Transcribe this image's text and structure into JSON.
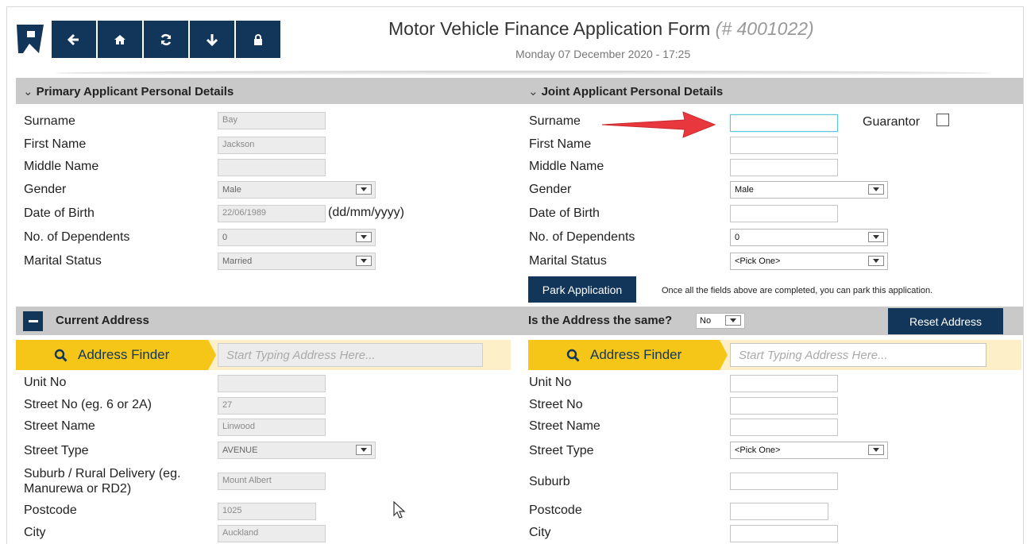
{
  "header": {
    "title": "Motor Vehicle Finance Application Form",
    "form_id": "(# 4001022)",
    "datetime": "Monday 07 December 2020 - 17:25"
  },
  "colors": {
    "navy": "#12365a",
    "yellow": "#f5c518",
    "section_grey": "#c9c9c9",
    "focus": "#5bc7d8",
    "arrow_red": "#e8383d"
  },
  "primary": {
    "section_title": "Primary Applicant Personal Details",
    "labels": {
      "surname": "Surname",
      "first_name": "First Name",
      "middle_name": "Middle Name",
      "gender": "Gender",
      "dob": "Date of Birth",
      "dependents": "No. of Dependents",
      "marital": "Marital Status"
    },
    "values": {
      "surname": "Bay",
      "first_name": "Jackson",
      "middle_name": "",
      "gender": "Male",
      "dob": "22/06/1989",
      "dependents": "0",
      "marital": "Married"
    },
    "dob_hint": "(dd/mm/yyyy)"
  },
  "joint": {
    "section_title": "Joint Applicant Personal Details",
    "guarantor_label": "Guarantor",
    "labels": {
      "surname": "Surname",
      "first_name": "First Name",
      "middle_name": "Middle Name",
      "gender": "Gender",
      "dob": "Date of Birth",
      "dependents": "No. of Dependents",
      "marital": "Marital Status"
    },
    "values": {
      "surname": "",
      "first_name": "",
      "middle_name": "",
      "gender": "Male",
      "dob": "",
      "dependents": "0",
      "marital": "<Pick One>"
    },
    "park_button": "Park Application",
    "park_note": "Once all the fields above are completed, you can park this application."
  },
  "address": {
    "section_title": "Current Address",
    "same_question": "Is the Address the same?",
    "same_value": "No",
    "reset_button": "Reset Address",
    "finder_label": "Address Finder",
    "finder_placeholder": "Start Typing Address Here...",
    "primary": {
      "labels": {
        "unit": "Unit No",
        "street_no": "Street No (eg. 6 or 2A)",
        "street_name": "Street Name",
        "street_type": "Street Type",
        "suburb": "Suburb / Rural Delivery (eg. Manurewa or RD2)",
        "postcode": "Postcode",
        "city": "City"
      },
      "values": {
        "unit": "",
        "street_no": "27",
        "street_name": "Linwood",
        "street_type": "AVENUE",
        "suburb": "Mount Albert",
        "postcode": "1025",
        "city": "Auckland"
      }
    },
    "joint": {
      "labels": {
        "unit": "Unit No",
        "street_no": "Street No",
        "street_name": "Street Name",
        "street_type": "Street Type",
        "suburb": "Suburb",
        "postcode": "Postcode",
        "city": "City"
      },
      "values": {
        "unit": "",
        "street_no": "",
        "street_name": "",
        "street_type": "<Pick One>",
        "suburb": "",
        "postcode": "",
        "city": ""
      }
    }
  }
}
